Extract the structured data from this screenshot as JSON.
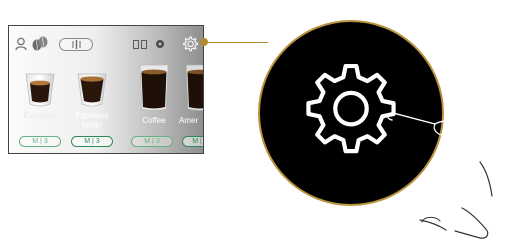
{
  "screen": {
    "icons": [
      "profile-icon",
      "coffee-beans-icon",
      "grinder-pill-icon",
      "cups-indicator-icon",
      "rinse-icon",
      "settings-gear-icon"
    ]
  },
  "drinks": [
    {
      "label": "Espresso",
      "chip": "M | 3"
    },
    {
      "label": "Espresso lungo",
      "chip": "M | 3"
    },
    {
      "label": "Coffee",
      "chip": "M | 3"
    },
    {
      "label": "Amer",
      "chip": "M |"
    }
  ],
  "callout": {
    "icon": "settings-gear-icon",
    "accent": "#b8923a",
    "pointer": "hand-tap-icon"
  }
}
